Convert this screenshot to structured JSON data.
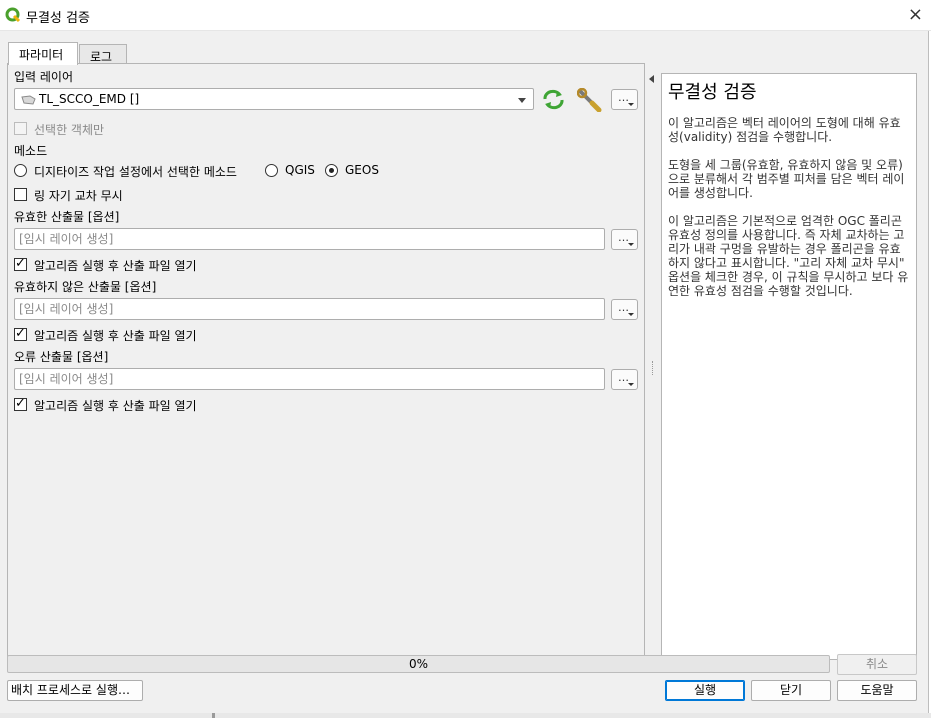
{
  "window": {
    "title": "무결성 검증",
    "close_icon": "×"
  },
  "tabs": [
    {
      "label": "파라미터"
    },
    {
      "label": "로그"
    }
  ],
  "params": {
    "input_layer": {
      "label": "입력 레이어",
      "value": "TL_SCCO_EMD []"
    },
    "selected_only": {
      "label": "선택한 객체만",
      "checked": false
    },
    "method": {
      "label": "메소드",
      "options": [
        {
          "label": "디지타이즈 작업 설정에서 선택한 메소드",
          "selected": false
        },
        {
          "label": "QGIS",
          "selected": false
        },
        {
          "label": "GEOS",
          "selected": true
        }
      ]
    },
    "ignore_ring": {
      "label": "링 자기 교차 무시",
      "checked": false
    },
    "valid_output": {
      "label": "유효한 산출물 [옵션]",
      "placeholder": "[임시 레이어 생성]",
      "open_label": "알고리즘 실행 후 산출 파일 열기",
      "open_checked": true
    },
    "invalid_output": {
      "label": "유효하지 않은 산출물 [옵션]",
      "placeholder": "[임시 레이어 생성]",
      "open_label": "알고리즘 실행 후 산출 파일 열기",
      "open_checked": true
    },
    "error_output": {
      "label": "오류 산출물 [옵션]",
      "placeholder": "[임시 레이어 생성]",
      "open_label": "알고리즘 실행 후 산출 파일 열기",
      "open_checked": true
    },
    "dots": "…"
  },
  "help": {
    "title": "무결성 검증",
    "paragraphs": [
      "이 알고리즘은 벡터 레이어의 도형에 대해 유효성(validity) 점검을 수행합니다.",
      "도형을 세 그룹(유효함, 유효하지 않음 및 오류)으로 분류해서 각 범주별 피처를 담은 벡터 레이어를 생성합니다.",
      "이 알고리즘은 기본적으로 엄격한 OGC 폴리곤 유효성 정의를 사용합니다. 즉 자체 교차하는 고리가 내곽 구멍을 유발하는 경우 폴리곤을 유효하지 않다고 표시합니다. \"고리 자체 교차 무시\" 옵션을 체크한 경우, 이 규칙을 무시하고 보다 유연한 유효성 점검을 수행할 것입니다."
    ]
  },
  "progress": {
    "value": 0,
    "text": "0%"
  },
  "buttons": {
    "cancel": "취소",
    "batch": "배치 프로세스로 실행…",
    "run": "실행",
    "close": "닫기",
    "help": "도움말"
  },
  "icons": {
    "app": "qgis-logo-icon",
    "refresh": "iterate-refresh-icon",
    "settings": "wrench-icon",
    "layer": "polygon-layer-icon"
  },
  "colors": {
    "accent": "#0078d7",
    "qgis_green": "#4aa02c",
    "progress_fill": "#06b025"
  }
}
